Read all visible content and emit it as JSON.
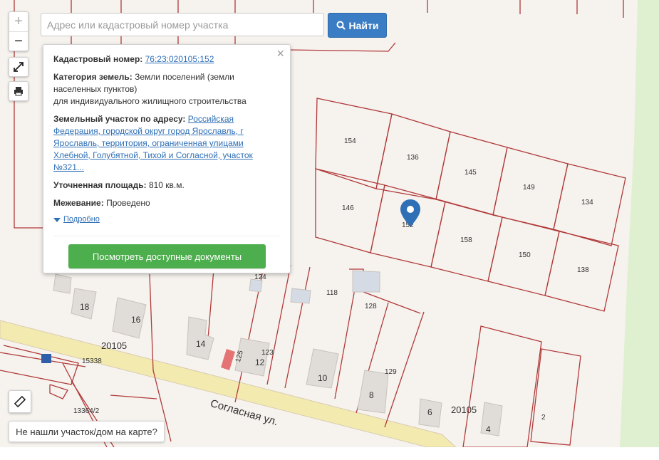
{
  "search": {
    "placeholder": "Адрес или кадастровый номер участка",
    "button_label": "Найти"
  },
  "zoom": {
    "in": "+",
    "out": "−"
  },
  "popup": {
    "cadastral_label": "Кадастровый номер:",
    "cadastral_number": "76:23:020105:152",
    "category_label": "Категория земель:",
    "category_value_1": "Земли поселений (земли населенных пунктов)",
    "category_value_2": "для индивидуального жилищного строительства",
    "address_label": "Земельный участок по адресу:",
    "address_value": "Российская Федерация, городской округ город Ярославль, г Ярославль, территория, ограниченная улицами Хлебной, Голубятной, Тихой и Согласной, участок №321...",
    "area_label": "Уточненная площадь:",
    "area_value": "810 кв.м.",
    "survey_label": "Межевание:",
    "survey_value": "Проведено",
    "details_link": "Подробно",
    "docs_button": "Посмотреть доступные документы",
    "close": "×"
  },
  "not_found_button": "Не нашли участок/дом на карте?",
  "map_labels": {
    "street": "Согласная ул.",
    "block_left": "20105",
    "block_right": "20105",
    "p15338": "15338",
    "p13364": "13364/2",
    "plots": [
      "154",
      "136",
      "145",
      "149",
      "134",
      "146",
      "152",
      "158",
      "150",
      "138",
      "118",
      "128",
      "129",
      "124",
      "123",
      "125",
      "12",
      "14",
      "16",
      "18",
      "10",
      "8",
      "6",
      "4",
      "2"
    ]
  },
  "icons": {
    "zoom_fullscreen": "expand-icon",
    "print": "printer-icon",
    "ruler": "ruler-icon",
    "search": "search-icon",
    "pin": "map-pin-icon"
  },
  "colors": {
    "parcel_line": "#b03a3a",
    "road": "#f3eab0",
    "primary": "#3a7dc4",
    "green": "#4cae4c",
    "green_area": "#dff0d0"
  }
}
